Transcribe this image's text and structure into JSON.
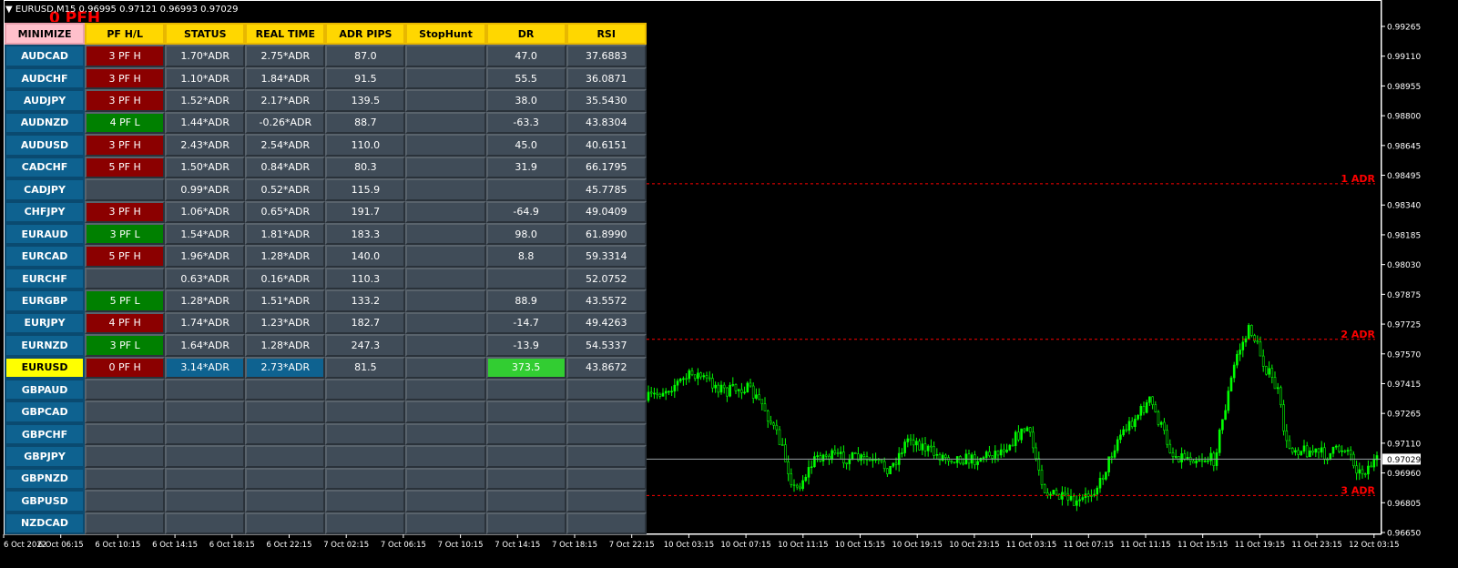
{
  "window": {
    "title": "EURUSD,M15  0.96995 0.97121 0.96993 0.97029",
    "overlay_text": "0 PFH"
  },
  "table": {
    "headers": [
      "MINIMIZE",
      "PF H/L",
      "STATUS",
      "REAL TIME",
      "ADR PIPS",
      "StopHunt",
      "DR",
      "RSI"
    ],
    "rows": [
      [
        "AUDCAD",
        "3 PF H",
        "1.70*ADR",
        "2.75*ADR",
        "87.0",
        "",
        "47.0",
        "37.6883"
      ],
      [
        "AUDCHF",
        "3 PF H",
        "1.10*ADR",
        "1.84*ADR",
        "91.5",
        "",
        "55.5",
        "36.0871"
      ],
      [
        "AUDJPY",
        "3 PF H",
        "1.52*ADR",
        "2.17*ADR",
        "139.5",
        "",
        "38.0",
        "35.5430"
      ],
      [
        "AUDNZD",
        "4 PF L",
        "1.44*ADR",
        "-0.26*ADR",
        "88.7",
        "",
        "-63.3",
        "43.8304"
      ],
      [
        "AUDUSD",
        "3 PF H",
        "2.43*ADR",
        "2.54*ADR",
        "110.0",
        "",
        "45.0",
        "40.6151"
      ],
      [
        "CADCHF",
        "5 PF H",
        "1.50*ADR",
        "0.84*ADR",
        "80.3",
        "",
        "31.9",
        "66.1795"
      ],
      [
        "CADJPY",
        "",
        "0.99*ADR",
        "0.52*ADR",
        "115.9",
        "",
        "",
        "45.7785"
      ],
      [
        "CHFJPY",
        "3 PF H",
        "1.06*ADR",
        "0.65*ADR",
        "191.7",
        "",
        "-64.9",
        "49.0409"
      ],
      [
        "EURAUD",
        "3 PF L",
        "1.54*ADR",
        "1.81*ADR",
        "183.3",
        "",
        "98.0",
        "61.8990"
      ],
      [
        "EURCAD",
        "5 PF H",
        "1.96*ADR",
        "1.28*ADR",
        "140.0",
        "",
        "8.8",
        "59.3314"
      ],
      [
        "EURCHF",
        "",
        "0.63*ADR",
        "0.16*ADR",
        "110.3",
        "",
        "",
        "52.0752"
      ],
      [
        "EURGBP",
        "5 PF L",
        "1.28*ADR",
        "1.51*ADR",
        "133.2",
        "",
        "88.9",
        "43.5572"
      ],
      [
        "EURJPY",
        "4 PF H",
        "1.74*ADR",
        "1.23*ADR",
        "182.7",
        "",
        "-14.7",
        "49.4263"
      ],
      [
        "EURNZD",
        "3 PF L",
        "1.64*ADR",
        "1.28*ADR",
        "247.3",
        "",
        "-13.9",
        "54.5337"
      ],
      [
        "EURUSD",
        "0 PF H",
        "3.14*ADR",
        "2.73*ADR",
        "81.5",
        "",
        "373.5",
        "43.8672"
      ],
      [
        "GBPAUD",
        "",
        "",
        "",
        "",
        "",
        "",
        ""
      ],
      [
        "GBPCAD",
        "",
        "",
        "",
        "",
        "",
        "",
        ""
      ],
      [
        "GBPCHF",
        "",
        "",
        "",
        "",
        "",
        "",
        ""
      ],
      [
        "GBPJPY",
        "",
        "",
        "",
        "",
        "",
        "",
        ""
      ],
      [
        "GBPNZD",
        "",
        "",
        "",
        "",
        "",
        "",
        ""
      ],
      [
        "GBPUSD",
        "",
        "",
        "",
        "",
        "",
        "",
        ""
      ],
      [
        "NZDCAD",
        "",
        "",
        "",
        "",
        "",
        "",
        ""
      ]
    ],
    "selected_symbol": "EURUSD"
  },
  "chart": {
    "symbol": "EURUSD",
    "timeframe": "M15",
    "price_axis": [
      "0.99265",
      "0.99110",
      "0.98955",
      "0.98800",
      "0.98645",
      "0.98495",
      "0.98340",
      "0.98185",
      "0.98030",
      "0.97875",
      "0.97725",
      "0.97570",
      "0.97415",
      "0.97265",
      "0.97110",
      "0.96960",
      "0.96805",
      "0.96650"
    ],
    "current_price": "0.97029",
    "time_axis": [
      "6 Oct 2022",
      "6 Oct 06:15",
      "6 Oct 10:15",
      "6 Oct 14:15",
      "6 Oct 18:15",
      "6 Oct 22:15",
      "7 Oct 02:15",
      "7 Oct 06:15",
      "7 Oct 10:15",
      "7 Oct 14:15",
      "7 Oct 18:15",
      "7 Oct 22:15",
      "10 Oct 03:15",
      "10 Oct 07:15",
      "10 Oct 11:15",
      "10 Oct 15:15",
      "10 Oct 19:15",
      "10 Oct 23:15",
      "11 Oct 03:15",
      "11 Oct 07:15",
      "11 Oct 11:15",
      "11 Oct 15:15",
      "11 Oct 19:15",
      "11 Oct 23:15",
      "12 Oct 03:15"
    ],
    "levels": [
      {
        "label": "1 ADR",
        "price": 0.98452
      },
      {
        "label": "2 ADR",
        "price": 0.97648
      },
      {
        "label": "3 ADR",
        "price": 0.96841
      }
    ],
    "colors": {
      "bull": "#00ff00",
      "bear": "#ffffff",
      "level": "#ff0000",
      "background": "#000000"
    }
  }
}
